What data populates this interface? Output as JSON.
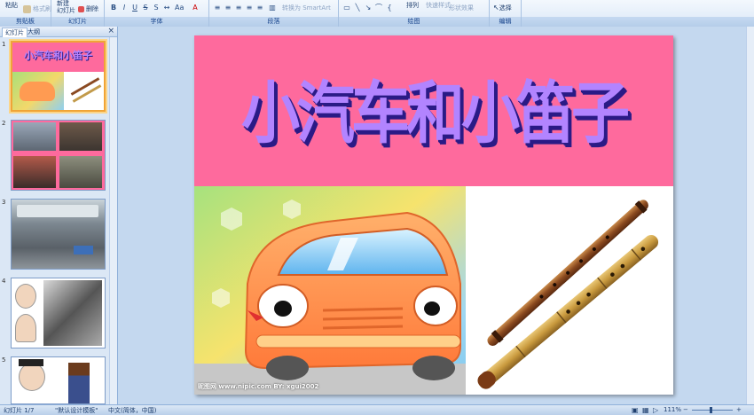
{
  "ribbon": {
    "clipboard": {
      "paste": "粘贴",
      "format_painter": "格式刷",
      "label": "剪贴板"
    },
    "slides": {
      "new_slide": "新建\n幻灯片",
      "delete": "删除",
      "label": "幻灯片"
    },
    "font": {
      "label": "字体"
    },
    "paragraph": {
      "label": "段落",
      "smartart": "转换为 SmartArt"
    },
    "drawing": {
      "arrange": "排列",
      "quick_styles": "快速样式",
      "shape_effects": "形状效果",
      "label": "绘图"
    },
    "editing": {
      "select": "选择",
      "label": "编辑"
    }
  },
  "left_pane": {
    "tabs": [
      "幻灯片",
      "大纲"
    ],
    "close": "×",
    "slide_numbers": [
      "1",
      "2",
      "3",
      "4",
      "5"
    ]
  },
  "slide": {
    "title": "小汽车和小笛子",
    "watermark": "昵图网 www.nipic.com  BY: xgui2002"
  },
  "status": {
    "slide_count": "幻灯片 1/7",
    "theme": "\"默认设计模板\"",
    "language": "中文(简体，中国)",
    "zoom": "111%"
  },
  "colors": {
    "title_band": "#fe6a9d",
    "title_text": "#b284ff",
    "title_shadow": "#2a1a86"
  }
}
